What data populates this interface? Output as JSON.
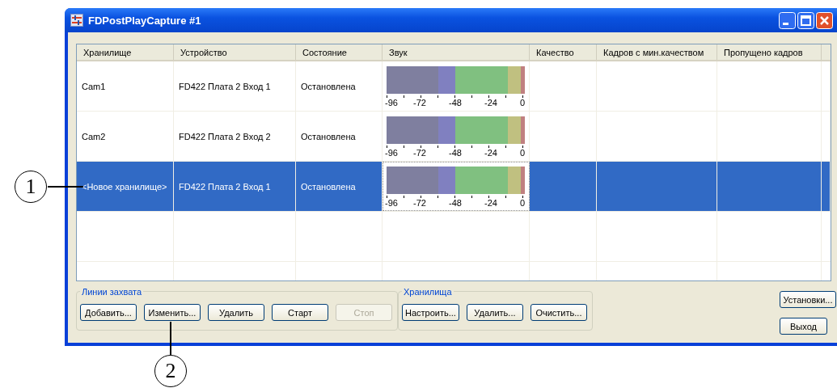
{
  "window": {
    "title": "FDPostPlayCapture #1"
  },
  "table": {
    "columns": [
      "Хранилище",
      "Устройство",
      "Состояние",
      "Звук",
      "Качество",
      "Кадров с мин.качеством",
      "Пропущено кадров"
    ],
    "rows": [
      {
        "storage": "Cam1",
        "device": "FD422 Плата 2 Вход 1",
        "state": "Остановлена",
        "meter_scale": [
          "-96",
          "-72",
          "-48",
          "-24",
          "0"
        ],
        "selected": false
      },
      {
        "storage": "Cam2",
        "device": "FD422 Плата 2 Вход 2",
        "state": "Остановлена",
        "meter_scale": [
          "-96",
          "-72",
          "-48",
          "-24",
          "0"
        ],
        "selected": false
      },
      {
        "storage": "<Новое хранилище>",
        "device": "FD422 Плата 2 Вход 1",
        "state": "Остановлена",
        "meter_scale": [
          "-96",
          "-72",
          "-48",
          "-24",
          "0"
        ],
        "selected": true
      }
    ]
  },
  "capture_group": {
    "title": "Линии захвата",
    "buttons": [
      {
        "label": "Добавить...",
        "disabled": false
      },
      {
        "label": "Изменить...",
        "disabled": false
      },
      {
        "label": "Удалить",
        "disabled": false
      },
      {
        "label": "Старт",
        "disabled": false
      },
      {
        "label": "Стоп",
        "disabled": true
      }
    ]
  },
  "storage_group": {
    "title": "Хранилища",
    "buttons": [
      {
        "label": "Настроить...",
        "disabled": false
      },
      {
        "label": "Удалить...",
        "disabled": false
      },
      {
        "label": "Очистить...",
        "disabled": false
      }
    ]
  },
  "side_buttons": [
    "Установки...",
    "Выход"
  ],
  "callouts": [
    "1",
    "2"
  ]
}
